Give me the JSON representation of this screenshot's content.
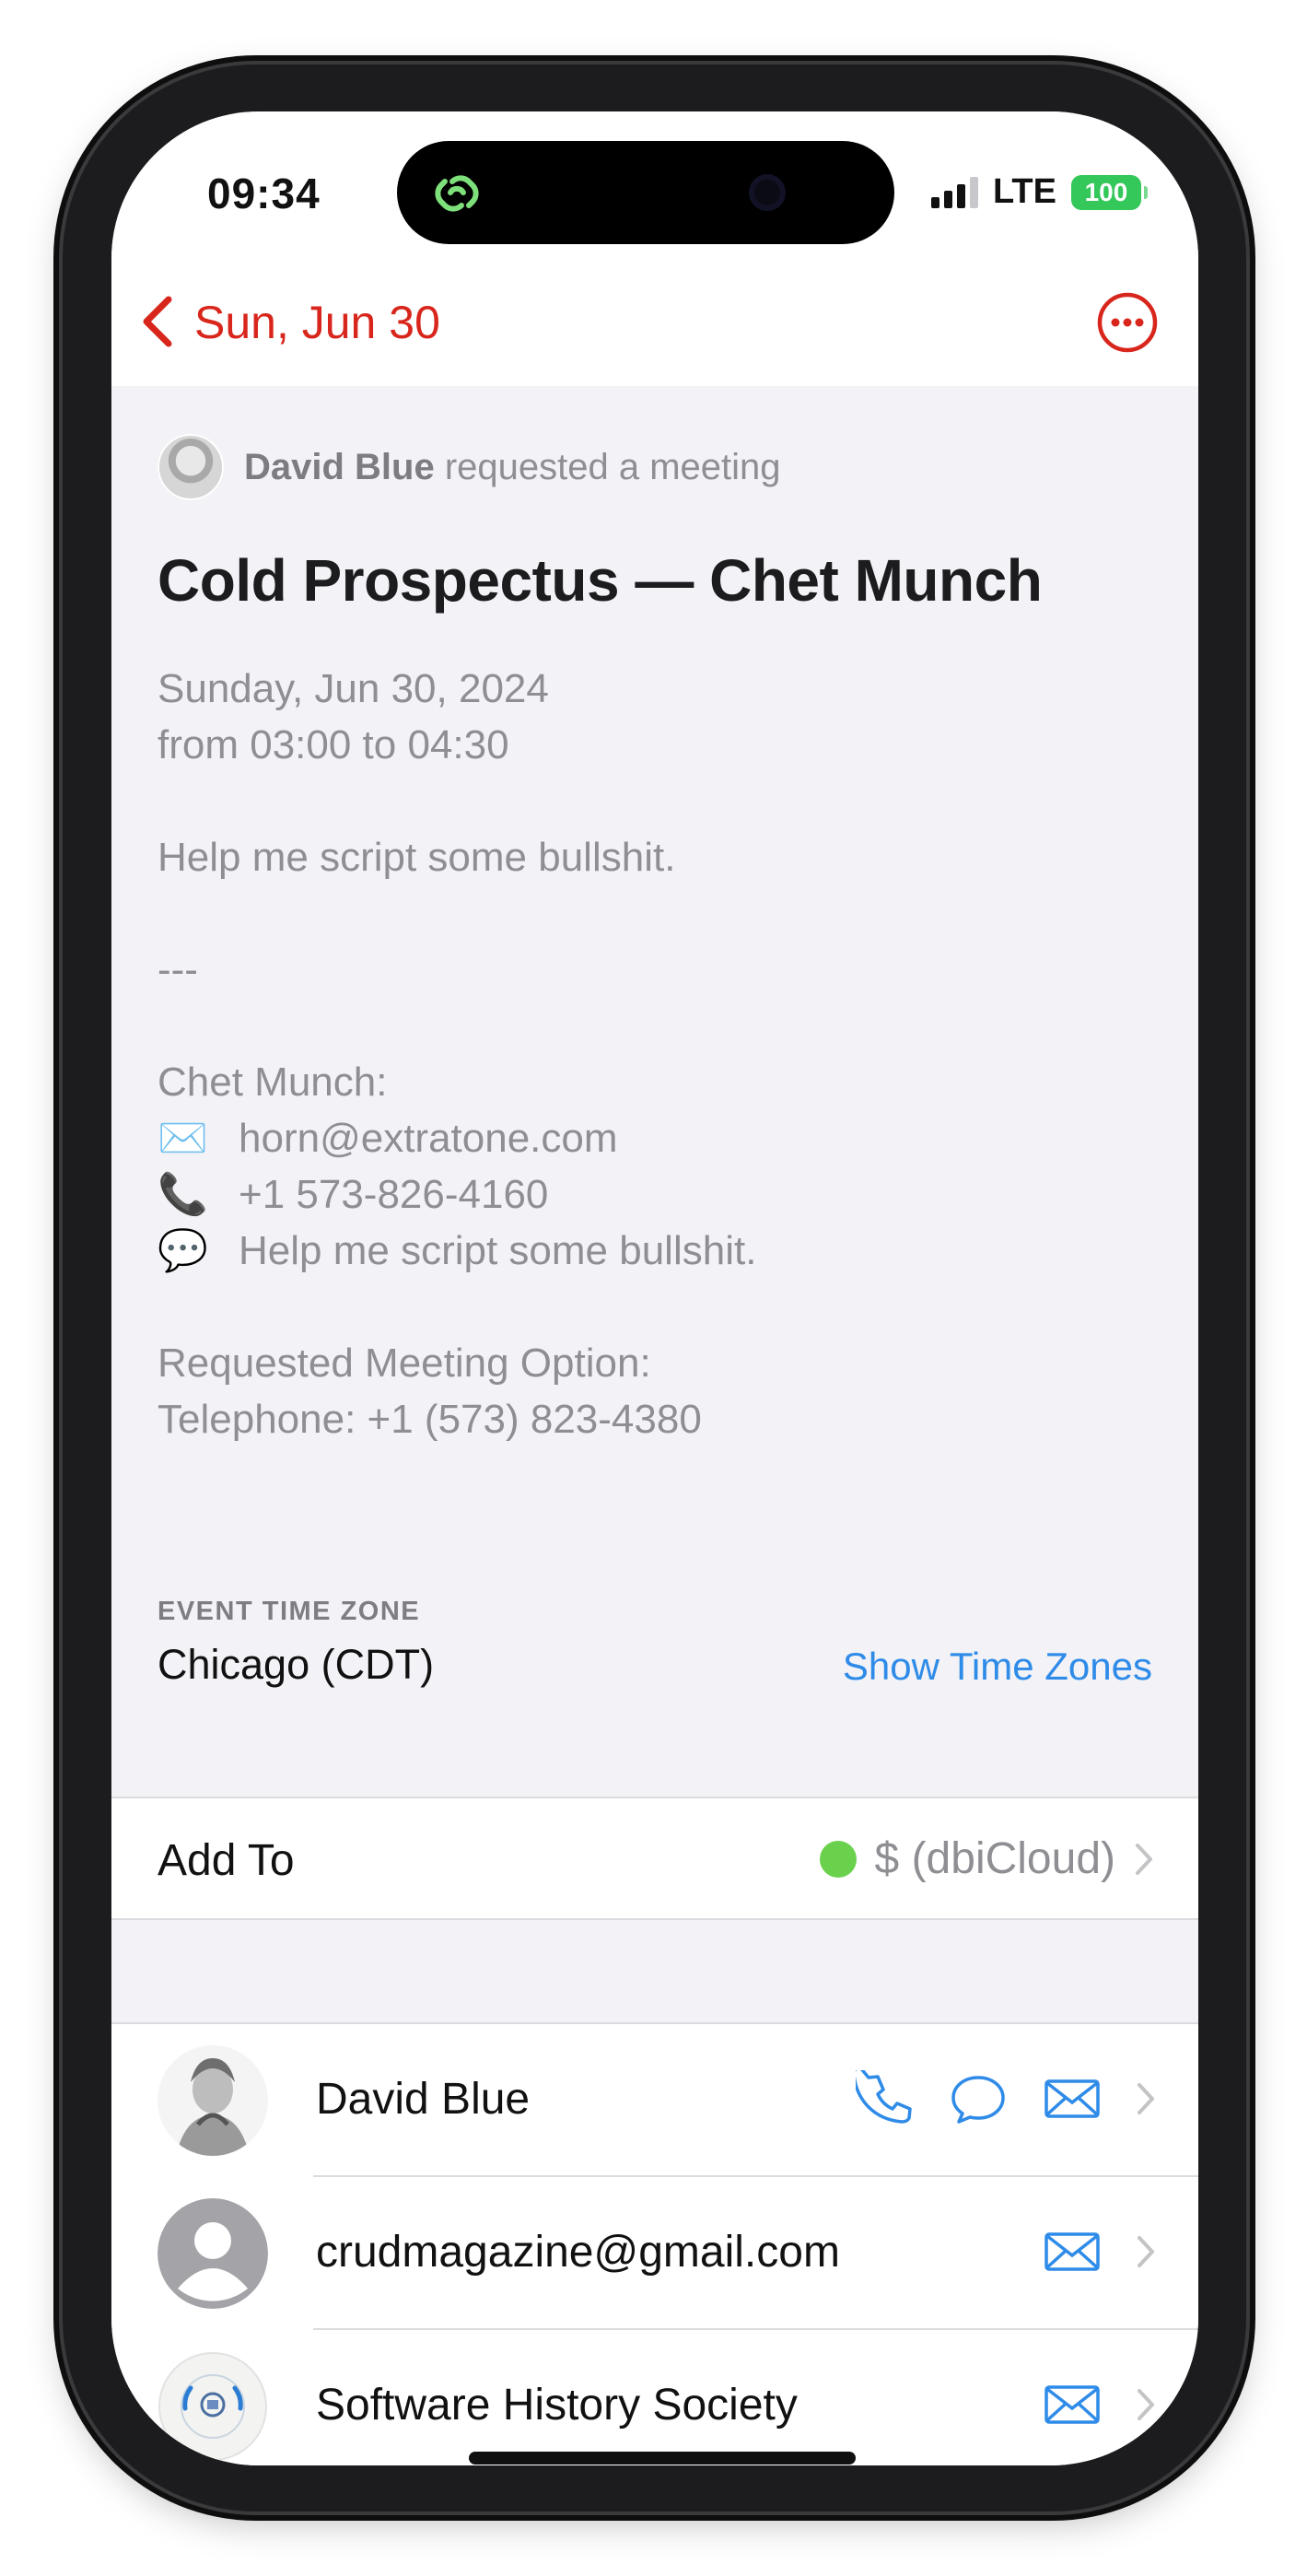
{
  "status_bar": {
    "time": "09:34",
    "network": "LTE",
    "battery": "100"
  },
  "nav": {
    "back_label": "Sun, Jun 30"
  },
  "event": {
    "requester_name": "David Blue",
    "requester_action": "requested a meeting",
    "title": "Cold Prospectus — Chet Munch",
    "date": "Sunday, Jun 30, 2024",
    "time_range": "from 03:00 to 04:30",
    "notes_summary": "Help me script some bullshit.",
    "divider": "---",
    "contact_heading": "Chet Munch:",
    "contact_email_emoji": "✉️",
    "contact_email": "horn@extratone.com",
    "contact_phone_emoji": "📞",
    "contact_phone": "+1 573-826-4160",
    "contact_message_emoji": "💬",
    "contact_message": "Help me script some bullshit.",
    "option_heading": "Requested Meeting Option:",
    "option_value": "Telephone: +1 (573) 823-4380"
  },
  "time_zone": {
    "label": "EVENT TIME ZONE",
    "value": "Chicago (CDT)",
    "link": "Show Time Zones"
  },
  "add_to": {
    "label": "Add To",
    "calendar_name": "$ (dbiCloud)",
    "calendar_color": "#6ad14d"
  },
  "attendees": [
    {
      "name": "David Blue",
      "actions": [
        "phone-icon",
        "message-icon",
        "mail-icon"
      ]
    },
    {
      "name": "crudmagazine@gmail.com",
      "actions": [
        "mail-icon"
      ]
    },
    {
      "name": "Software History Society",
      "actions": [
        "mail-icon"
      ]
    }
  ],
  "colors": {
    "accent_red": "#d8261c",
    "link_blue": "#2f8be8",
    "battery_green": "#34c759"
  }
}
